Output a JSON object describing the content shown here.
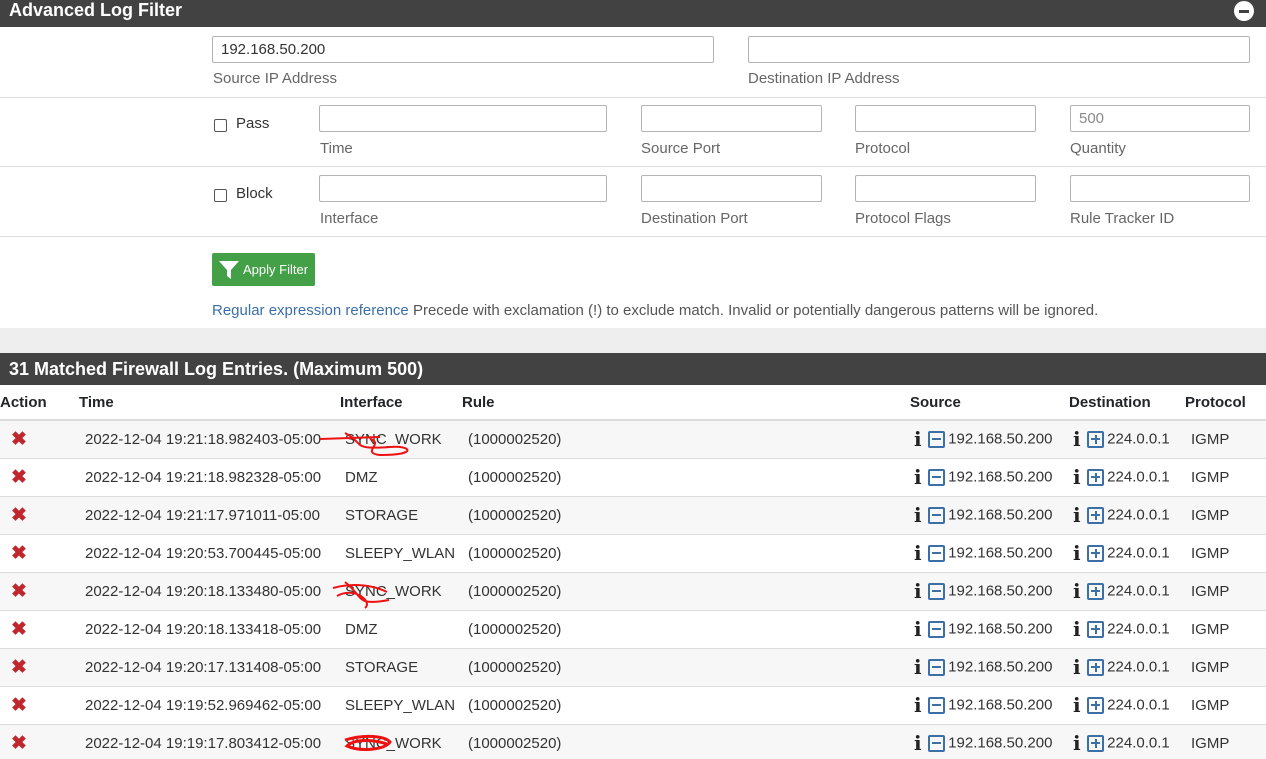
{
  "filter_panel": {
    "title": "Advanced Log Filter",
    "source_ip": {
      "value": "192.168.50.200",
      "label": "Source IP Address"
    },
    "destination_ip": {
      "value": "",
      "label": "Destination IP Address"
    },
    "pass_label": "Pass",
    "block_label": "Block",
    "time": {
      "label": "Time",
      "value": ""
    },
    "source_port": {
      "label": "Source Port",
      "value": ""
    },
    "protocol": {
      "label": "Protocol",
      "value": ""
    },
    "quantity": {
      "label": "Quantity",
      "placeholder": "500"
    },
    "interface": {
      "label": "Interface",
      "value": ""
    },
    "destination_port": {
      "label": "Destination Port",
      "value": ""
    },
    "protocol_flags": {
      "label": "Protocol Flags",
      "value": ""
    },
    "rule_tracker": {
      "label": "Rule Tracker ID",
      "value": ""
    },
    "apply_label": "Apply Filter",
    "regex_link": "Regular expression reference",
    "help_text": " Precede with exclamation (!) to exclude match. Invalid or potentially dangerous patterns will be ignored."
  },
  "log_panel": {
    "title": "31 Matched Firewall Log Entries. (Maximum 500)",
    "columns": [
      "Action",
      "Time",
      "Interface",
      "Rule",
      "Source",
      "Destination",
      "Protocol"
    ],
    "rows": [
      {
        "time": "2022-12-04 19:21:18.982403-05:00",
        "interface": "SYNC_WORK",
        "rule": "(1000002520)",
        "source": "192.168.50.200",
        "destination": "224.0.0.1",
        "protocol": "IGMP"
      },
      {
        "time": "2022-12-04 19:21:18.982328-05:00",
        "interface": "DMZ",
        "rule": "(1000002520)",
        "source": "192.168.50.200",
        "destination": "224.0.0.1",
        "protocol": "IGMP"
      },
      {
        "time": "2022-12-04 19:21:17.971011-05:00",
        "interface": "STORAGE",
        "rule": "(1000002520)",
        "source": "192.168.50.200",
        "destination": "224.0.0.1",
        "protocol": "IGMP"
      },
      {
        "time": "2022-12-04 19:20:53.700445-05:00",
        "interface": "SLEEPY_WLAN",
        "rule": "(1000002520)",
        "source": "192.168.50.200",
        "destination": "224.0.0.1",
        "protocol": "IGMP"
      },
      {
        "time": "2022-12-04 19:20:18.133480-05:00",
        "interface": "SYNC_WORK",
        "rule": "(1000002520)",
        "source": "192.168.50.200",
        "destination": "224.0.0.1",
        "protocol": "IGMP"
      },
      {
        "time": "2022-12-04 19:20:18.133418-05:00",
        "interface": "DMZ",
        "rule": "(1000002520)",
        "source": "192.168.50.200",
        "destination": "224.0.0.1",
        "protocol": "IGMP"
      },
      {
        "time": "2022-12-04 19:20:17.131408-05:00",
        "interface": "STORAGE",
        "rule": "(1000002520)",
        "source": "192.168.50.200",
        "destination": "224.0.0.1",
        "protocol": "IGMP"
      },
      {
        "time": "2022-12-04 19:19:52.969462-05:00",
        "interface": "SLEEPY_WLAN",
        "rule": "(1000002520)",
        "source": "192.168.50.200",
        "destination": "224.0.0.1",
        "protocol": "IGMP"
      },
      {
        "time": "2022-12-04 19:19:17.803412-05:00",
        "interface": "SYNC_WORK",
        "rule": "(1000002520)",
        "source": "192.168.50.200",
        "destination": "224.0.0.1",
        "protocol": "IGMP"
      }
    ]
  },
  "icons": {
    "block": "block-x-icon",
    "info": "info-icon",
    "minus": "minus-square-icon",
    "plus": "plus-square-icon",
    "filter": "filter-icon",
    "collapse": "minus-circle-icon"
  },
  "colors": {
    "header_bg": "#424242",
    "apply_button": "#43a047",
    "block_icon": "#c0272d",
    "link": "#3b6fa8"
  }
}
